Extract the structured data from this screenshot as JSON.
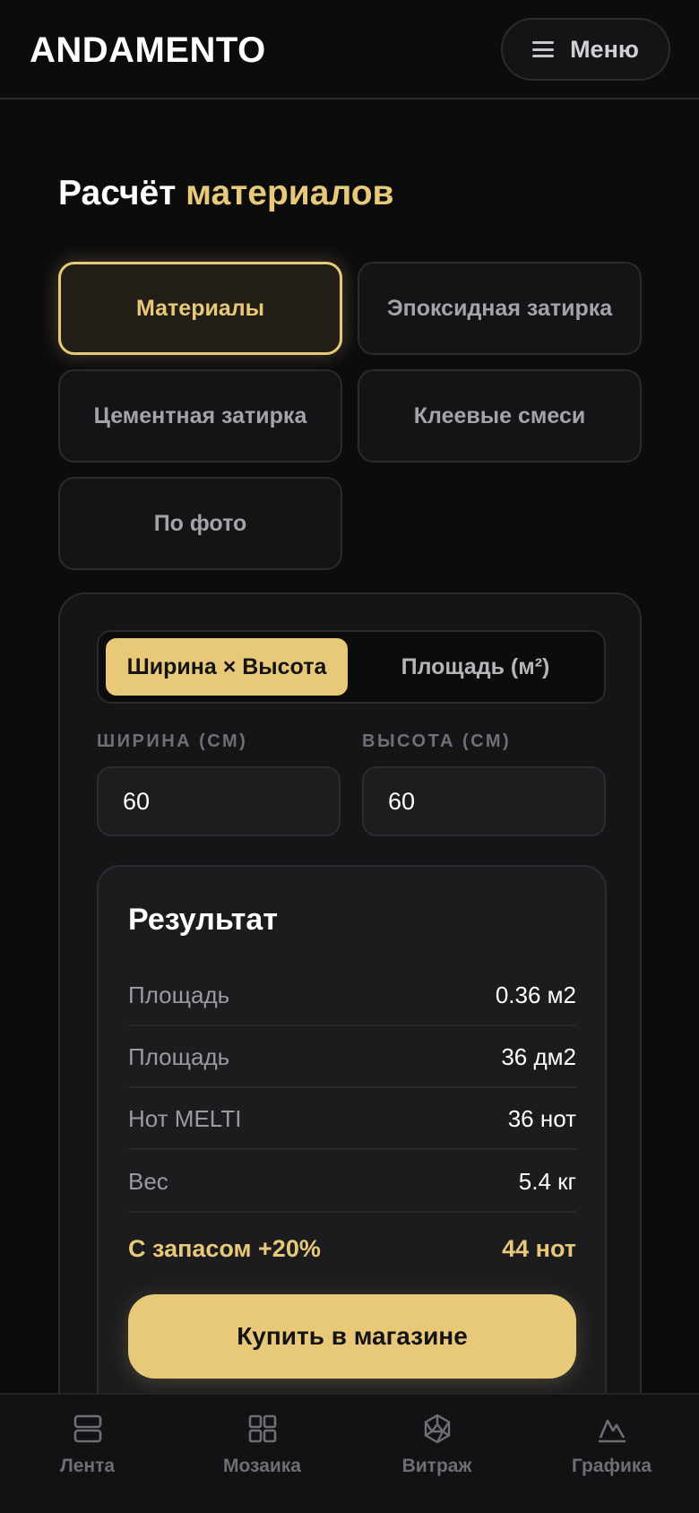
{
  "header": {
    "logo": "ANDAMENTO",
    "menu_label": "Меню"
  },
  "page": {
    "title_main": "Расчёт",
    "title_accent": "материалов"
  },
  "mode_tabs": [
    {
      "label": "Материалы",
      "active": true
    },
    {
      "label": "Эпоксидная затирка",
      "active": false
    },
    {
      "label": "Цементная затирка",
      "active": false
    },
    {
      "label": "Клеевые смеси",
      "active": false
    },
    {
      "label": "По фото",
      "active": false
    }
  ],
  "calculator": {
    "segment": {
      "active_label": "Ширина × Высота",
      "inactive_label": "Площадь (м²)"
    },
    "width": {
      "label": "ШИРИНА (СМ)",
      "value": "60"
    },
    "height": {
      "label": "ВЫСОТА (СМ)",
      "value": "60"
    }
  },
  "result": {
    "title": "Результат",
    "rows": [
      {
        "key": "Площадь",
        "value": "0.36 м2"
      },
      {
        "key": "Площадь",
        "value": "36 дм2"
      },
      {
        "key": "Нот MELTI",
        "value": "36 нот"
      },
      {
        "key": "Вес",
        "value": "5.4 кг"
      }
    ],
    "total": {
      "key": "С запасом +20%",
      "value": "44 нот"
    },
    "buy_label": "Купить в магазине"
  },
  "bottom_nav": [
    {
      "label": "Лента",
      "icon": "feed-icon"
    },
    {
      "label": "Мозаика",
      "icon": "grid-icon"
    },
    {
      "label": "Витраж",
      "icon": "stained-glass-icon"
    },
    {
      "label": "Графика",
      "icon": "mountain-icon"
    }
  ],
  "colors": {
    "accent": "#e8c97a",
    "background": "#0c0c0d",
    "card": "#151517"
  }
}
